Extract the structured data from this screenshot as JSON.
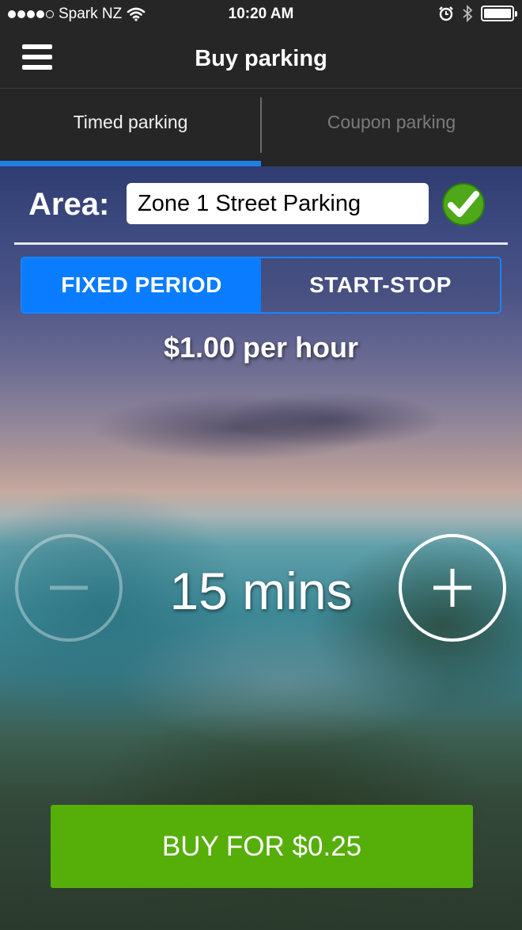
{
  "status_bar": {
    "carrier": "Spark NZ",
    "time": "10:20 AM",
    "signal_dots_filled": 4,
    "signal_dots_total": 5,
    "icons": [
      "wifi-icon",
      "alarm-icon",
      "bluetooth-icon",
      "battery-icon"
    ]
  },
  "nav": {
    "title": "Buy parking",
    "menu_icon": "hamburger-menu-icon"
  },
  "tabs": [
    {
      "label": "Timed parking",
      "active": true
    },
    {
      "label": "Coupon parking",
      "active": false
    }
  ],
  "area": {
    "label": "Area:",
    "value": "Zone 1 Street Parking",
    "status_icon": "check-circle-icon"
  },
  "mode": {
    "options": [
      "FIXED PERIOD",
      "START-STOP"
    ],
    "selected": "FIXED PERIOD"
  },
  "rate": "$1.00 per hour",
  "duration": {
    "value": "15 mins",
    "decrease_icon": "minus-icon",
    "increase_icon": "plus-icon"
  },
  "buy_button": {
    "label": "BUY FOR $0.25"
  },
  "colors": {
    "accent_blue": "#0a7cff",
    "buy_green": "#56ae09",
    "check_green": "#4ea81a",
    "bar_dark": "#262626"
  }
}
